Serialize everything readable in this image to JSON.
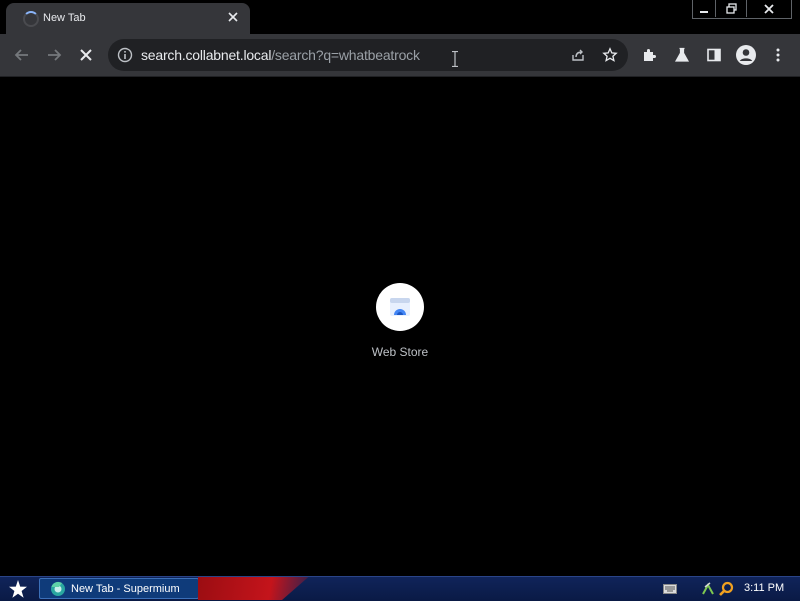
{
  "window": {
    "tab_title": "New Tab",
    "controls": {
      "minimize_icon": "minimize-icon",
      "restore_icon": "restore-icon",
      "close_icon": "close-icon"
    }
  },
  "toolbar": {
    "url_host": "search.collabnet.local",
    "url_path": "/search?q=whatbeatrock",
    "icons": [
      "back-arrow-icon",
      "forward-arrow-icon",
      "stop-icon",
      "site-info-icon",
      "share-icon",
      "bookmark-star-icon",
      "extensions-icon",
      "labs-flask-icon",
      "side-panel-icon",
      "profile-icon",
      "menu-icon"
    ]
  },
  "content": {
    "shortcut_label": "Web Store"
  },
  "taskbar": {
    "task_label": "New Tab - Supermium",
    "clock": "3:11 PM"
  },
  "colors": {
    "chrome_bg": "#35363a",
    "omnibox_bg": "#202124",
    "page_bg": "#000000",
    "taskbar_bg": "#10245a"
  }
}
